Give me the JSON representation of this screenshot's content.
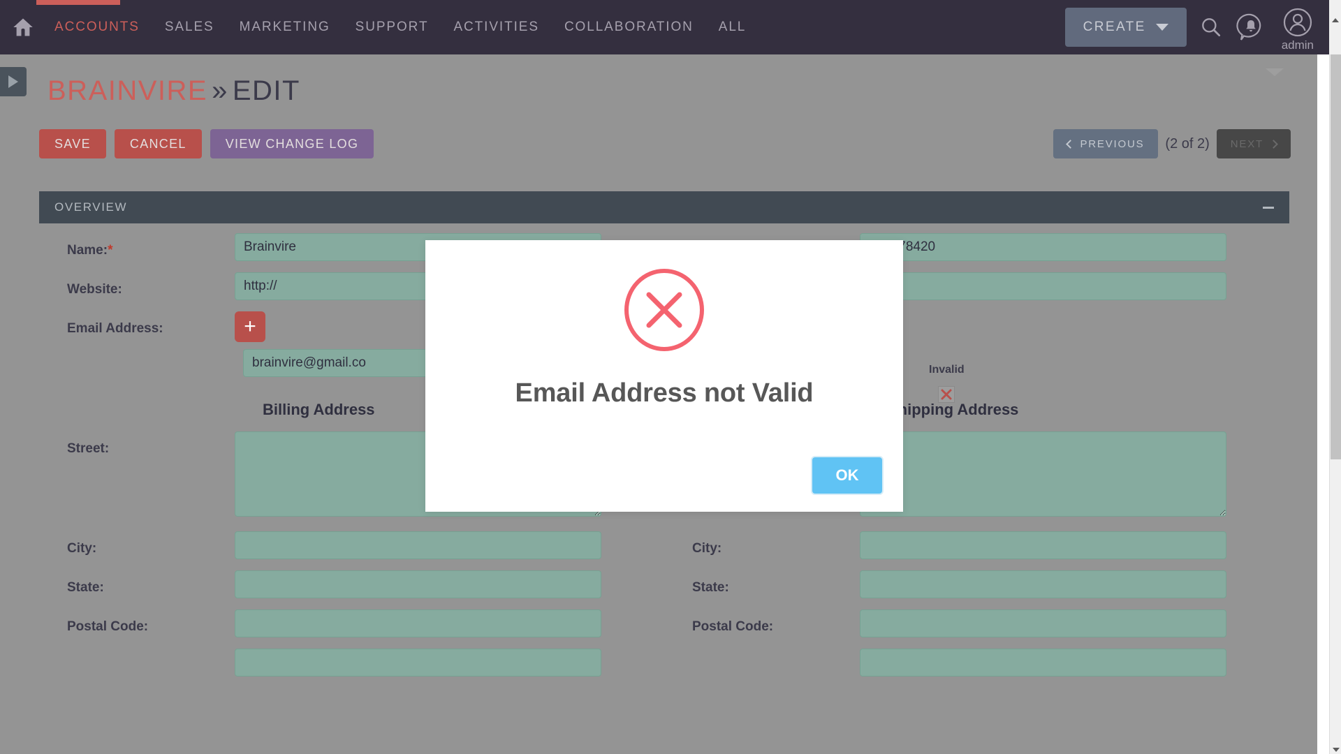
{
  "navbar": {
    "home_icon": "home-icon",
    "links": [
      {
        "label": "ACCOUNTS",
        "active": true
      },
      {
        "label": "SALES",
        "active": false
      },
      {
        "label": "MARKETING",
        "active": false
      },
      {
        "label": "SUPPORT",
        "active": false
      },
      {
        "label": "ACTIVITIES",
        "active": false
      },
      {
        "label": "COLLABORATION",
        "active": false
      },
      {
        "label": "ALL",
        "active": false
      }
    ],
    "create_label": "CREATE",
    "search_icon": "search-icon",
    "notifications_icon": "notification-bell-icon",
    "avatar_icon": "user-avatar-icon",
    "user_name": "admin",
    "accent_color": "#cc5f5a",
    "background_color": "#342f3f"
  },
  "breadcrumb": {
    "module": "BRAINVIRE",
    "separator": "»",
    "action": "EDIT"
  },
  "actions": {
    "save_label": "SAVE",
    "cancel_label": "CANCEL",
    "changelog_label": "VIEW CHANGE LOG"
  },
  "pager": {
    "previous_label": "PREVIOUS",
    "count_label": "(2 of 2)",
    "next_label": "NEXT"
  },
  "panel": {
    "title": "OVERVIEW",
    "collapse_icon": "minus-icon"
  },
  "form": {
    "name": {
      "label": "Name:",
      "required_marker": "*",
      "value": "Brainvire",
      "placeholder": ""
    },
    "phone": {
      "label": "",
      "value": "510378420",
      "placeholder": ""
    },
    "website": {
      "label": "Website:",
      "value": "http://",
      "placeholder": "http://"
    },
    "website_right": {
      "label": "",
      "value": "",
      "placeholder": ""
    },
    "email": {
      "label": "Email Address:",
      "add_button_label": "+",
      "value": "brainvire@gmail.co",
      "placeholder": "",
      "invalid_label": "Invalid",
      "invalid_icon": "red-x-icon"
    },
    "billing": {
      "section_title": "Billing Address",
      "street": {
        "label": "Street:",
        "value": "",
        "placeholder": ""
      },
      "city": {
        "label": "City:",
        "value": "",
        "placeholder": ""
      },
      "state": {
        "label": "State:",
        "value": "",
        "placeholder": ""
      },
      "postal": {
        "label": "Postal Code:",
        "value": "",
        "placeholder": ""
      }
    },
    "shipping": {
      "section_title": "Shipping Address",
      "street": {
        "label": "Street:",
        "value": "",
        "placeholder": ""
      },
      "city": {
        "label": "City:",
        "value": "",
        "placeholder": ""
      },
      "state": {
        "label": "State:",
        "value": "",
        "placeholder": ""
      },
      "postal": {
        "label": "Postal Code:",
        "value": "",
        "placeholder": ""
      }
    },
    "field_bg_color": "#86ab9f"
  },
  "modal": {
    "icon": "error-circle-x-icon",
    "icon_color": "#f4636f",
    "title": "Email Address not Valid",
    "ok_label": "OK",
    "ok_color": "#60c3f4"
  },
  "sidebar_toggle": {
    "icon": "expand-sidebar-triangle-icon"
  },
  "scrollbar": {
    "vertical_position_percent": 58
  }
}
